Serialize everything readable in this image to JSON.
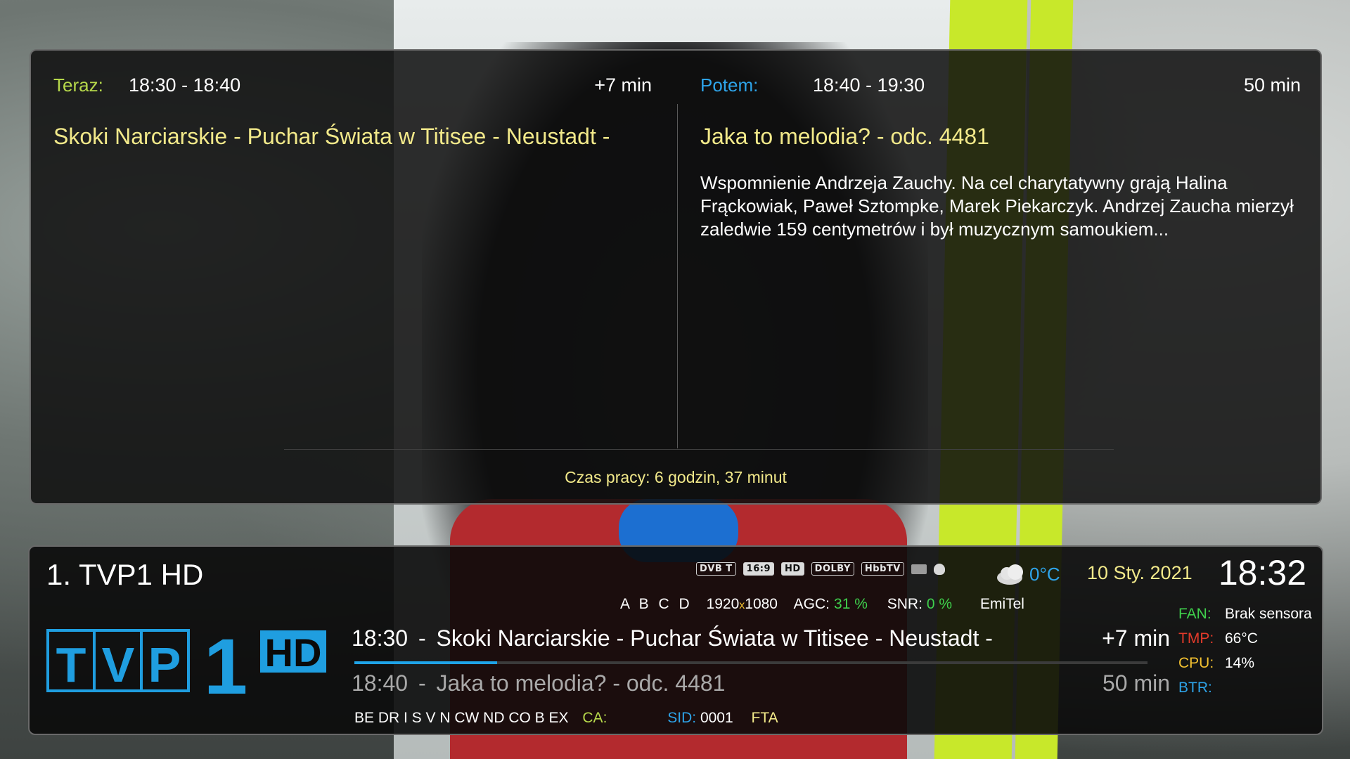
{
  "epg_panel": {
    "now": {
      "label": "Teraz:",
      "time": "18:30 - 18:40",
      "duration": "+7 min",
      "title": "Skoki Narciarskie - Puchar Świata w Titisee - Neustadt -"
    },
    "next": {
      "label": "Potem:",
      "time": "18:40 - 19:30",
      "duration": "50 min",
      "title": "Jaka to melodia? - odc. 4481",
      "description": " Wspomnienie Andrzeja Zauchy. Na cel charytatywny grają Halina Frąckowiak, Paweł Sztompke, Marek Piekarczyk. Andrzej Zaucha mierzył zaledwie 159 centymetrów i był muzycznym samoukiem..."
    },
    "uptime": "Czas pracy: 6 godzin, 37 minut"
  },
  "infobar": {
    "channel_name": "1. TVP1 HD",
    "icons": [
      {
        "name": "dvbt-icon",
        "text": "DVB T"
      },
      {
        "name": "aspect-16-9-icon",
        "text": "16:9"
      },
      {
        "name": "hd-icon",
        "text": "HD"
      },
      {
        "name": "dolby-digital-icon",
        "text": "DOLBY"
      },
      {
        "name": "hbbtv-icon",
        "text": "HbbTV"
      }
    ],
    "weather": {
      "icon": "cloudy-icon",
      "temp": "0°C"
    },
    "date": "10 Sty. 2021",
    "clock": "18:32",
    "tech": {
      "abcd": "A B C D",
      "res_w": "1920",
      "res_x": "x",
      "res_h": "1080",
      "agc_label": "AGC:",
      "agc_value": "31 %",
      "snr_label": "SNR:",
      "snr_value": "0 %",
      "provider": "EmiTel"
    },
    "logo": {
      "letters": [
        "T",
        "V",
        "P"
      ],
      "number": "1",
      "hd": "HD",
      "color": "#1f9ee0"
    },
    "now": {
      "time": "18:30",
      "sep": "-",
      "title": "Skoki Narciarskie - Puchar Świata w Titisee - Neustadt -",
      "duration": "+7 min",
      "progress": 0.18
    },
    "next": {
      "time": "18:40",
      "sep": "-",
      "title": "Jaka to melodia? - odc. 4481",
      "duration": "50 min"
    },
    "codes": "BE DR I S V N CW ND CO B EX",
    "ca_label": "CA:",
    "sid_label": "SID:",
    "sid_value": "0001",
    "fta": "FTA",
    "sysinfo": [
      {
        "key": "FAN:",
        "value": "Brak sensora",
        "color": "#3fd04c"
      },
      {
        "key": "TMP:",
        "value": "66°C",
        "color": "#e23a2a"
      },
      {
        "key": "CPU:",
        "value": "14%",
        "color": "#f2c030"
      },
      {
        "key": "BTR:",
        "value": "",
        "color": "#2ea4e9"
      }
    ]
  }
}
